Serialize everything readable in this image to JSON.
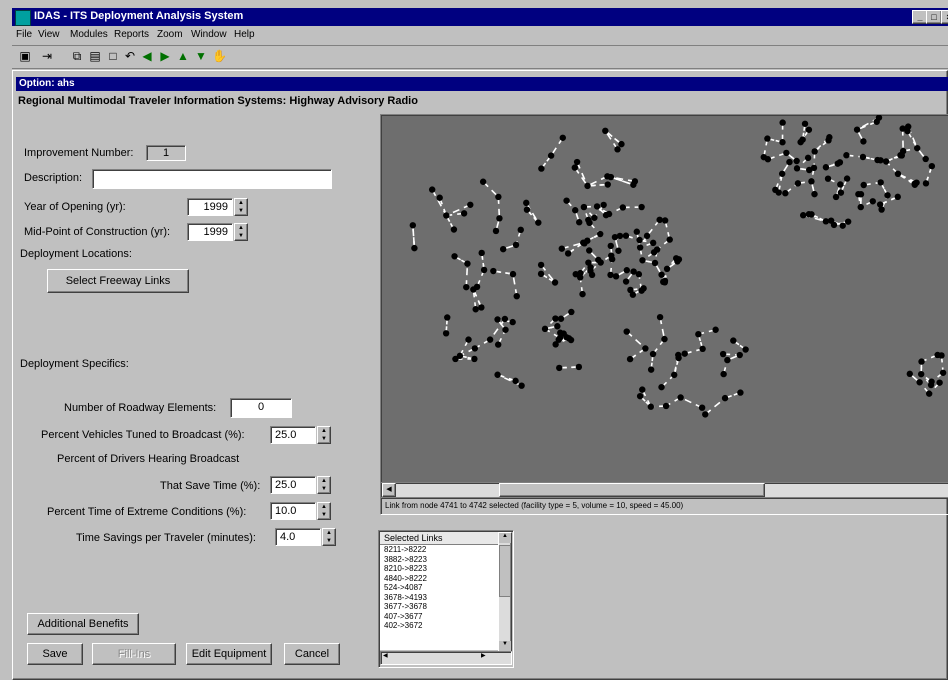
{
  "app": {
    "title": "IDAS - ITS Deployment Analysis System",
    "window_controls": [
      "_",
      "□",
      "×"
    ]
  },
  "menu": [
    "File",
    "View",
    "Modules",
    "Reports",
    "Zoom",
    "Window",
    "Help"
  ],
  "toolbar_icons": [
    "print-icon",
    "exit-icon",
    "copy-icon",
    "paste-icon",
    "new-icon",
    "undo-icon",
    "first-icon",
    "last-icon",
    "up-icon",
    "down-icon",
    "pan-icon"
  ],
  "dialog": {
    "title": "Option: ahs",
    "heading": "Regional Multimodal Traveler Information Systems: Highway Advisory Radio"
  },
  "form": {
    "improvement_number_label": "Improvement Number:",
    "improvement_number": "1",
    "description_label": "Description:",
    "description": "",
    "year_opening_label": "Year of Opening (yr):",
    "year_opening": "1999",
    "midpoint_label": "Mid-Point of Construction (yr):",
    "midpoint": "1999",
    "deployment_locations_label": "Deployment Locations:",
    "select_links_button": "Select Freeway Links",
    "deployment_specifics_label": "Deployment Specifics:",
    "roadway_elements_label": "Number of Roadway Elements:",
    "roadway_elements": "0",
    "pct_tuned_label": "Percent Vehicles Tuned to Broadcast (%):",
    "pct_tuned": "25.0",
    "pct_hearing_label": "Percent of Drivers Hearing Broadcast",
    "save_time_label": "That Save Time (%):",
    "save_time": "25.0",
    "extreme_label": "Percent Time of Extreme Conditions (%):",
    "extreme": "10.0",
    "savings_label": "Time Savings per Traveler (minutes):",
    "savings": "4.0"
  },
  "buttons": {
    "additional_benefits": "Additional Benefits",
    "save": "Save",
    "fill_ins": "Fill-Ins",
    "edit_equipment": "Edit Equipment",
    "cancel": "Cancel"
  },
  "map_status": "Link from node 4741 to 4742 selected (facility type = 5, volume =    10, speed = 45.00)",
  "selected_links": {
    "header": "Selected Links",
    "items": [
      "8211->8222",
      "3882->8223",
      "8210->8223",
      "4840->8222",
      "524->4087",
      "3678->4193",
      "3677->3678",
      "407->3677",
      "402->3672"
    ]
  },
  "colors": {
    "titlebar": "#000080",
    "map_background": "#6e6e6e",
    "map_nodes": "#000000",
    "map_links": "#ffffff"
  }
}
